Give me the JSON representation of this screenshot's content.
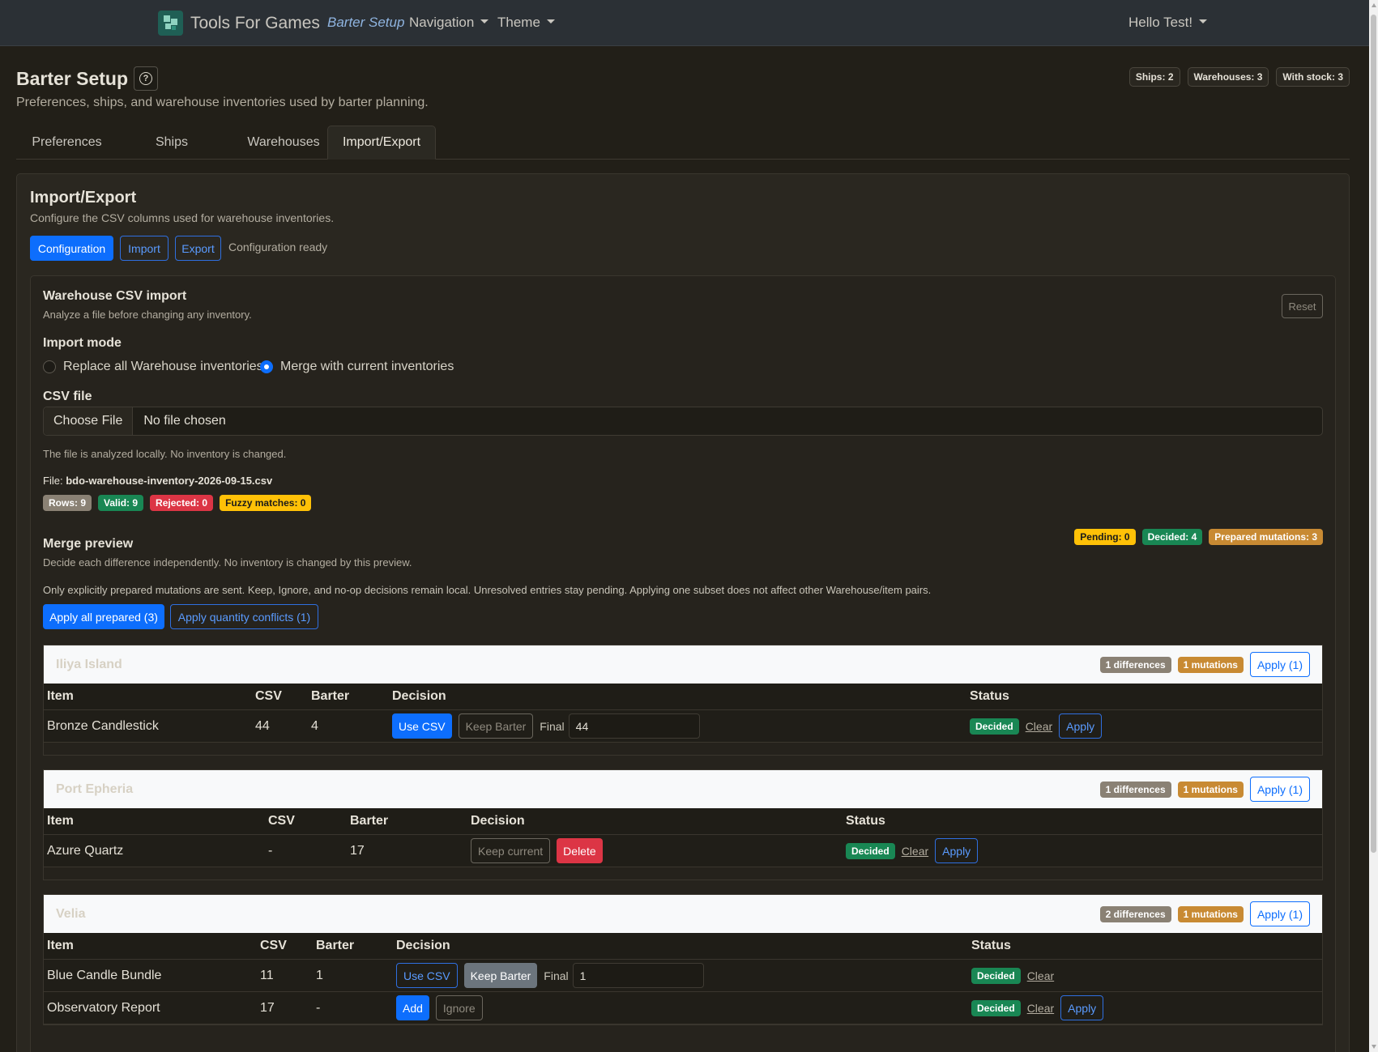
{
  "nav": {
    "brand": "Tools For Games",
    "active_link": "Barter Setup",
    "navigation": "Navigation",
    "theme": "Theme",
    "user": "Hello Test!"
  },
  "header": {
    "title": "Barter Setup",
    "subtitle": "Preferences, ships, and warehouse inventories used by barter planning.",
    "badges": [
      "Ships: 2",
      "Warehouses: 3",
      "With stock: 3"
    ]
  },
  "tabs": [
    "Preferences",
    "Ships",
    "Warehouses",
    "Import/Export"
  ],
  "card": {
    "title": "Import/Export",
    "subtitle": "Configure the CSV columns used for warehouse inventories.",
    "buttons": {
      "configuration": "Configuration",
      "import": "Import",
      "export": "Export"
    },
    "status": "Configuration ready"
  },
  "import": {
    "title": "Warehouse CSV import",
    "subtitle": "Analyze a file before changing any inventory.",
    "reset": "Reset",
    "mode_label": "Import mode",
    "mode_replace": "Replace all Warehouse inventories",
    "mode_merge": "Merge with current inventories",
    "csv_label": "CSV file",
    "choose_file": "Choose File",
    "no_file": "No file chosen",
    "help": "The file is analyzed locally. No inventory is changed.",
    "file_prefix": "File:",
    "file_name": "bdo-warehouse-inventory-2026-09-15.csv",
    "stats": {
      "rows": "Rows: 9",
      "valid": "Valid: 9",
      "rejected": "Rejected: 0",
      "fuzzy": "Fuzzy matches: 0"
    }
  },
  "merge": {
    "title": "Merge preview",
    "subtitle": "Decide each difference independently. No inventory is changed by this preview.",
    "note": "Only explicitly prepared mutations are sent. Keep, Ignore, and no-op decisions remain local. Unresolved entries stay pending. Applying one subset does not affect other Warehouse/item pairs.",
    "pending": "Pending: 0",
    "decided": "Decided: 4",
    "prepared": "Prepared mutations: 3",
    "apply_all": "Apply all prepared (3)",
    "apply_conflicts": "Apply quantity conflicts (1)"
  },
  "columns": {
    "item": "Item",
    "csv": "CSV",
    "barter": "Barter",
    "decision": "Decision",
    "status": "Status"
  },
  "labels": {
    "final": "Final",
    "decided": "Decided",
    "clear": "Clear",
    "apply": "Apply",
    "use_csv": "Use CSV",
    "keep_barter": "Keep Barter",
    "keep_current": "Keep current",
    "delete": "Delete",
    "add": "Add",
    "ignore": "Ignore"
  },
  "groups": [
    {
      "name": "Iliya Island",
      "differences": "1 differences",
      "mutations": "1 mutations",
      "apply": "Apply (1)",
      "rows": [
        {
          "item": "Bronze Candlestick",
          "csv": "44",
          "barter": "4",
          "final": "44"
        }
      ]
    },
    {
      "name": "Port Epheria",
      "differences": "1 differences",
      "mutations": "1 mutations",
      "apply": "Apply (1)",
      "rows": [
        {
          "item": "Azure Quartz",
          "csv": "-",
          "barter": "17"
        }
      ]
    },
    {
      "name": "Velia",
      "differences": "2 differences",
      "mutations": "1 mutations",
      "apply": "Apply (1)",
      "rows": [
        {
          "item": "Blue Candle Bundle",
          "csv": "11",
          "barter": "1",
          "final": "1"
        },
        {
          "item": "Observatory Report",
          "csv": "17",
          "barter": "-"
        }
      ]
    }
  ]
}
